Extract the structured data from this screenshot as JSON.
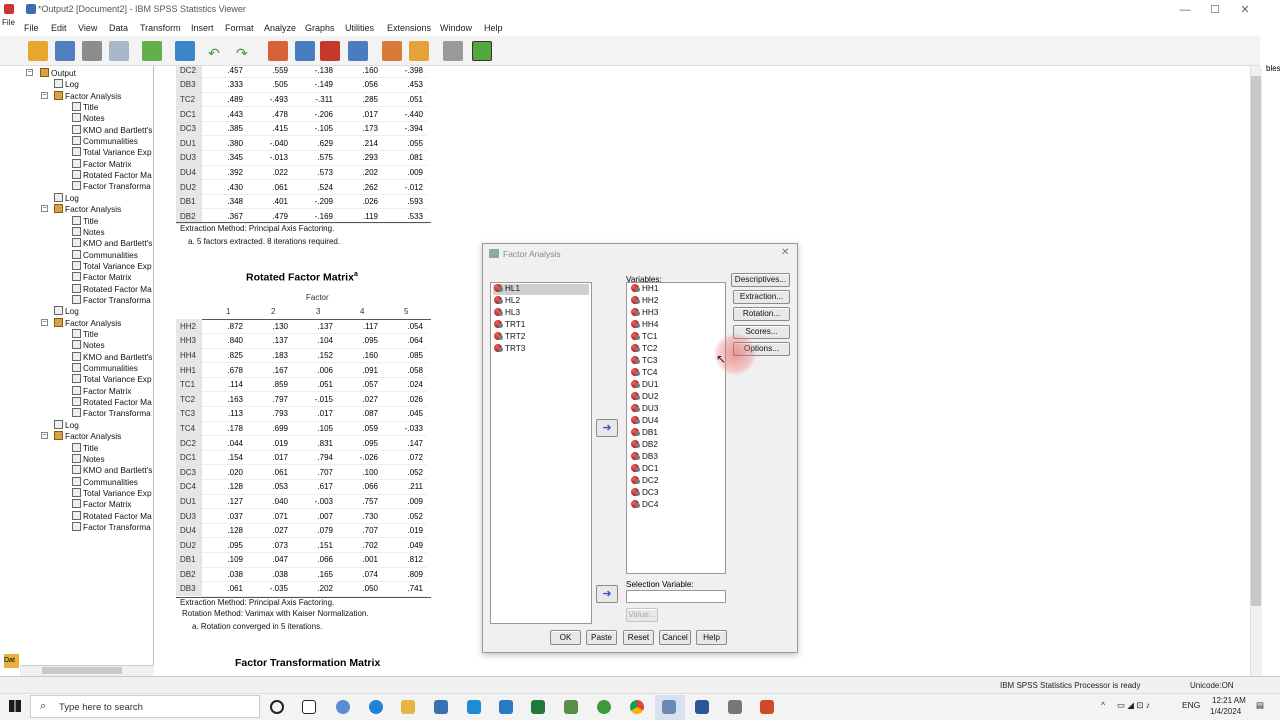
{
  "window": {
    "title": "*Output2 [Document2] - IBM SPSS Statistics Viewer",
    "minimize": "—",
    "maximize": "☐",
    "close": "✕"
  },
  "menu": [
    "File",
    "Edit",
    "View",
    "Data",
    "Transform",
    "Insert",
    "Format",
    "Analyze",
    "Graphs",
    "Utilities",
    "Extensions",
    "Window",
    "Help"
  ],
  "left_edge_labels": {
    "file": "File",
    "dat": "Dat"
  },
  "right_edge_label": "bles",
  "tree": {
    "root": "Output",
    "groups": [
      {
        "log": "Log",
        "analysis": "Factor Analysis",
        "items": [
          "Title",
          "Notes",
          "KMO and Bartlett's",
          "Communalities",
          "Total Variance Exp",
          "Factor Matrix",
          "Rotated Factor Ma",
          "Factor Transforma"
        ]
      },
      {
        "log": "Log",
        "analysis": "Factor Analysis",
        "items": [
          "Title",
          "Notes",
          "KMO and Bartlett's",
          "Communalities",
          "Total Variance Exp",
          "Factor Matrix",
          "Rotated Factor Ma",
          "Factor Transforma"
        ]
      },
      {
        "log": "Log",
        "analysis": "Factor Analysis",
        "items": [
          "Title",
          "Notes",
          "KMO and Bartlett's",
          "Communalities",
          "Total Variance Exp",
          "Factor Matrix",
          "Rotated Factor Ma",
          "Factor Transforma"
        ]
      },
      {
        "log": "Log",
        "analysis": "Factor Analysis",
        "items": [
          "Title",
          "Notes",
          "KMO and Bartlett's",
          "Communalities",
          "Total Variance Exp",
          "Factor Matrix",
          "Rotated Factor Ma",
          "Factor Transforma"
        ]
      }
    ]
  },
  "factor_matrix_tail": {
    "rows": [
      [
        "DC2",
        ".457",
        ".559",
        "-.138",
        ".160",
        "-.398"
      ],
      [
        "DB3",
        ".333",
        ".505",
        "-.149",
        ".056",
        ".453"
      ],
      [
        "TC2",
        ".489",
        "-.493",
        "-.311",
        ".285",
        ".051"
      ],
      [
        "DC1",
        ".443",
        ".478",
        "-.206",
        ".017",
        "-.440"
      ],
      [
        "DC3",
        ".385",
        ".415",
        "-.105",
        ".173",
        "-.394"
      ],
      [
        "DU1",
        ".380",
        "-.040",
        ".629",
        ".214",
        ".055"
      ],
      [
        "DU3",
        ".345",
        "-.013",
        ".575",
        ".293",
        ".081"
      ],
      [
        "DU4",
        ".392",
        ".022",
        ".573",
        ".202",
        ".009"
      ],
      [
        "DU2",
        ".430",
        ".061",
        ".524",
        ".262",
        "-.012"
      ],
      [
        "DB1",
        ".348",
        ".401",
        "-.209",
        ".026",
        ".593"
      ],
      [
        "DB2",
        ".367",
        ".479",
        "-.169",
        ".119",
        ".533"
      ]
    ],
    "note1": "Extraction Method: Principal Axis Factoring.",
    "note2": "a. 5 factors extracted. 8 iterations required."
  },
  "rotated": {
    "title": "Rotated Factor Matrix",
    "sup": "a",
    "factor_label": "Factor",
    "cols": [
      "1",
      "2",
      "3",
      "4",
      "5"
    ],
    "rows": [
      [
        "HH2",
        ".872",
        ".130",
        ".137",
        ".117",
        ".054"
      ],
      [
        "HH3",
        ".840",
        ".137",
        ".104",
        ".095",
        ".064"
      ],
      [
        "HH4",
        ".825",
        ".183",
        ".152",
        ".160",
        ".085"
      ],
      [
        "HH1",
        ".678",
        ".167",
        ".006",
        ".091",
        ".058"
      ],
      [
        "TC1",
        ".114",
        ".859",
        ".051",
        ".057",
        ".024"
      ],
      [
        "TC2",
        ".163",
        ".797",
        "-.015",
        ".027",
        ".026"
      ],
      [
        "TC3",
        ".113",
        ".793",
        ".017",
        ".087",
        ".045"
      ],
      [
        "TC4",
        ".178",
        ".699",
        ".105",
        ".059",
        "-.033"
      ],
      [
        "DC2",
        ".044",
        ".019",
        ".831",
        ".095",
        ".147"
      ],
      [
        "DC1",
        ".154",
        ".017",
        ".794",
        "-.026",
        ".072"
      ],
      [
        "DC3",
        ".020",
        ".061",
        ".707",
        ".100",
        ".052"
      ],
      [
        "DC4",
        ".128",
        ".053",
        ".617",
        ".066",
        ".211"
      ],
      [
        "DU1",
        ".127",
        ".040",
        "-.003",
        ".757",
        ".009"
      ],
      [
        "DU3",
        ".037",
        ".071",
        ".007",
        ".730",
        ".052"
      ],
      [
        "DU4",
        ".128",
        ".027",
        ".079",
        ".707",
        ".019"
      ],
      [
        "DU2",
        ".095",
        ".073",
        ".151",
        ".702",
        ".049"
      ],
      [
        "DB1",
        ".109",
        ".047",
        ".066",
        ".001",
        ".812"
      ],
      [
        "DB2",
        ".038",
        ".038",
        ".165",
        ".074",
        ".809"
      ],
      [
        "DB3",
        ".061",
        "-.035",
        ".202",
        ".050",
        ".741"
      ]
    ],
    "note1": "Extraction Method: Principal Axis Factoring.",
    "note2": "Rotation Method: Varimax with Kaiser Normalization.",
    "note3": "a. Rotation converged in 5 iterations."
  },
  "transformation_title": "Factor Transformation Matrix",
  "dialog": {
    "title": "Factor Analysis",
    "close": "✕",
    "source_vars": [
      "HL1",
      "HL2",
      "HL3",
      "TRT1",
      "TRT2",
      "TRT3"
    ],
    "variables_label": "Variables:",
    "variables": [
      "HH1",
      "HH2",
      "HH3",
      "HH4",
      "TC1",
      "TC2",
      "TC3",
      "TC4",
      "DU1",
      "DU2",
      "DU3",
      "DU4",
      "DB1",
      "DB2",
      "DB3",
      "DC1",
      "DC2",
      "DC3",
      "DC4"
    ],
    "side_buttons": [
      "Descriptives...",
      "Extraction...",
      "Rotation...",
      "Scores...",
      "Options..."
    ],
    "selection_label": "Selection Variable:",
    "value_button": "Value...",
    "arrow": "➜",
    "bottom_buttons": [
      "OK",
      "Paste",
      "Reset",
      "Cancel",
      "Help"
    ]
  },
  "status": {
    "processor": "IBM SPSS Statistics Processor is ready",
    "unicode": "Unicode:ON"
  },
  "taskbar": {
    "search_placeholder": "Type here to search",
    "lang": "ENG",
    "time": "12:21 AM",
    "date": "1/4/2024"
  }
}
